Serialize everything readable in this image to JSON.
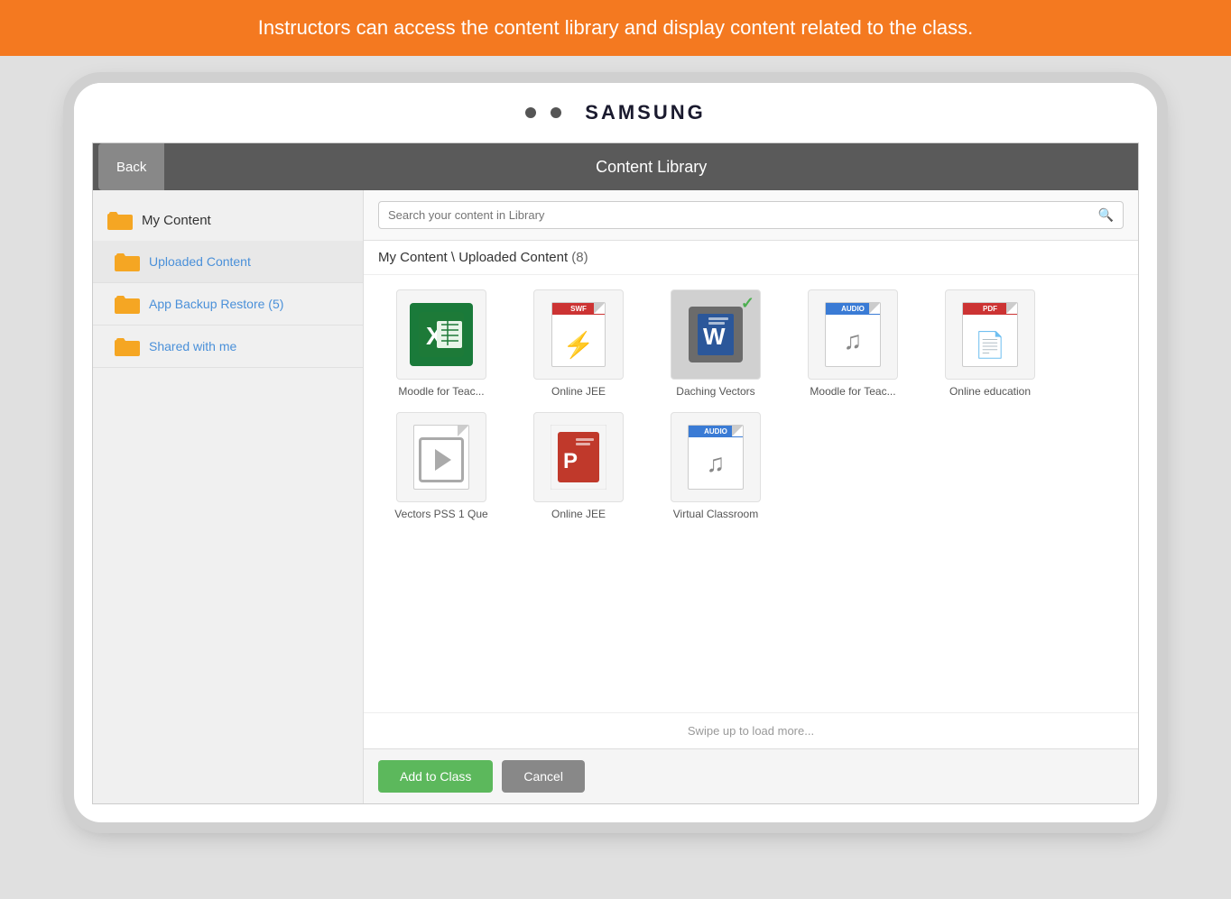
{
  "banner": {
    "text": "Instructors can access the content library and display content related to the class."
  },
  "device": {
    "brand": "SAMSUNG"
  },
  "app": {
    "back_label": "Back",
    "title": "Content Library",
    "search_placeholder": "Search your content in Library",
    "breadcrumb": "My Content \\ Uploaded Content",
    "item_count": "(8)",
    "swipe_hint": "Swipe up to load more...",
    "add_label": "Add to Class",
    "cancel_label": "Cancel"
  },
  "sidebar": {
    "my_content_label": "My Content",
    "items": [
      {
        "label": "Uploaded Content",
        "active": true
      },
      {
        "label": "App Backup Restore (5)",
        "active": false
      },
      {
        "label": "Shared with me",
        "active": false
      }
    ]
  },
  "grid": {
    "rows": [
      [
        {
          "id": "item1",
          "name": "Moodle for Teac...",
          "type": "excel"
        },
        {
          "id": "item2",
          "name": "Online JEE",
          "type": "swf"
        },
        {
          "id": "item3",
          "name": "Daching Vectors",
          "type": "word",
          "selected": true
        },
        {
          "id": "item4",
          "name": "Moodle for Teac...",
          "type": "audio"
        },
        {
          "id": "item5",
          "name": "Online education",
          "type": "pdf"
        }
      ],
      [
        {
          "id": "item6",
          "name": "Vectors PSS 1 Que",
          "type": "video"
        },
        {
          "id": "item7",
          "name": "Online JEE",
          "type": "ppt"
        },
        {
          "id": "item8",
          "name": "Virtual Classroom",
          "type": "audio"
        }
      ]
    ]
  }
}
